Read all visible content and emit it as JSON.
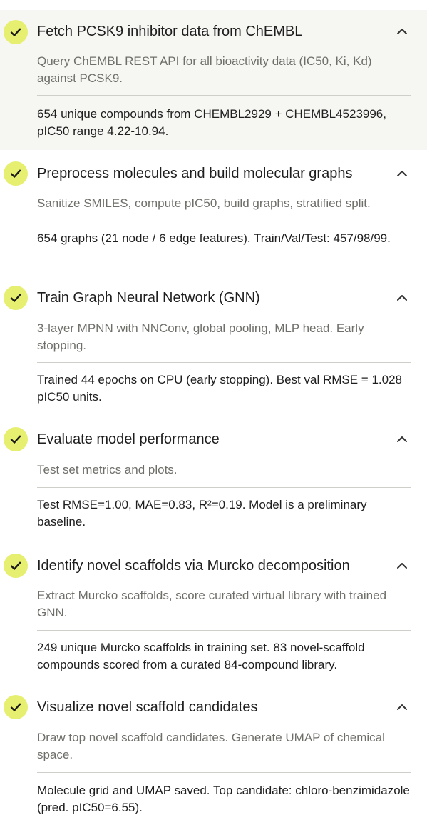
{
  "steps": [
    {
      "title": "Fetch PCSK9 inhibitor data from ChEMBL",
      "description": "Query ChEMBL REST API for all bioactivity data (IC50, Ki, Kd) against PCSK9.",
      "result": "654 unique compounds from CHEMBL2929 + CHEMBL4523996, pIC50 range 4.22-10.94."
    },
    {
      "title": "Preprocess molecules and build molecular graphs",
      "description": "Sanitize SMILES, compute pIC50, build graphs, stratified split.",
      "result": "654 graphs (21 node / 6 edge features). Train/Val/Test: 457/98/99."
    },
    {
      "title": "Train Graph Neural Network (GNN)",
      "description": "3-layer MPNN with NNConv, global pooling, MLP head. Early stopping.",
      "result": "Trained 44 epochs on CPU (early stopping). Best val RMSE = 1.028 pIC50 units."
    },
    {
      "title": "Evaluate model performance",
      "description": "Test set metrics and plots.",
      "result": "Test RMSE=1.00, MAE=0.83, R²=0.19. Model is a preliminary baseline."
    },
    {
      "title": "Identify novel scaffolds via Murcko decomposition",
      "description": "Extract Murcko scaffolds, score curated virtual library with trained GNN.",
      "result": "249 unique Murcko scaffolds in training set. 83 novel-scaffold compounds scored from a curated 84-compound library."
    },
    {
      "title": "Visualize novel scaffold candidates",
      "description": "Draw top novel scaffold candidates. Generate UMAP of chemical space.",
      "result": "Molecule grid and UMAP saved. Top candidate: chloro-benzimidazole (pred. pIC50=6.55)."
    }
  ],
  "icons": {
    "status": "check-icon",
    "toggle": "chevron-up-icon"
  },
  "colors": {
    "check_bg": "#e6ef6f",
    "active_bg": "#f6f6f3",
    "muted_text": "#6f6f6a"
  }
}
